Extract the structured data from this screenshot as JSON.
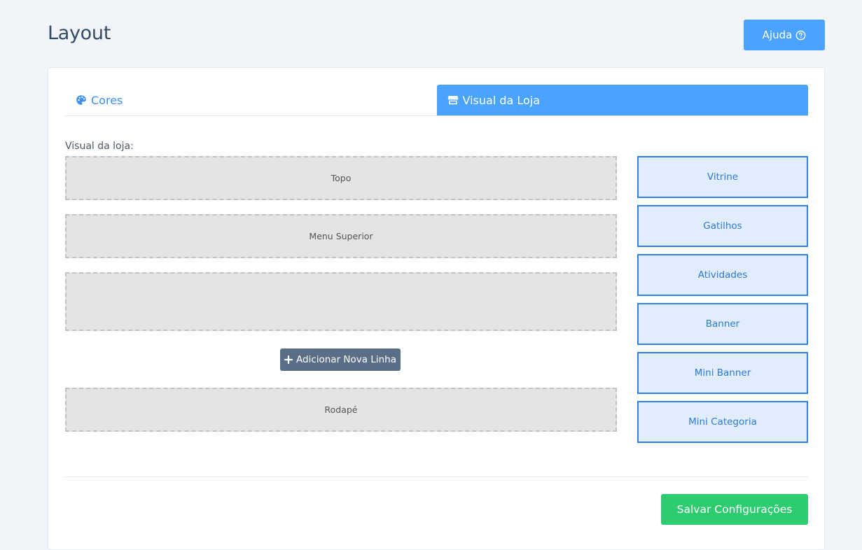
{
  "page": {
    "title": "Layout"
  },
  "header": {
    "help_label": "Ajuda",
    "help_icon": "question-circle-icon"
  },
  "tabs": [
    {
      "label": "Cores",
      "icon": "palette-icon",
      "active": false
    },
    {
      "label": "Visual da Loja",
      "icon": "store-icon",
      "active": true
    }
  ],
  "layout_editor": {
    "label": "Visual da loja:",
    "slots": {
      "top": "Topo",
      "menu": "Menu Superior",
      "content": "",
      "footer": "Rodapé"
    },
    "add_row_label": "Adicionar Nova Linha",
    "add_row_icon": "plus-icon"
  },
  "widgets": [
    "Vitrine",
    "Gatilhos",
    "Atividades",
    "Banner",
    "Mini Banner",
    "Mini Categoria"
  ],
  "footer": {
    "save_label": "Salvar Configurações"
  },
  "colors": {
    "primary": "#4aa3ff",
    "success": "#2ecc71",
    "widget_border": "#2c82e6",
    "widget_bg": "#e1ecfc",
    "secondary_button": "#5a6f87"
  }
}
